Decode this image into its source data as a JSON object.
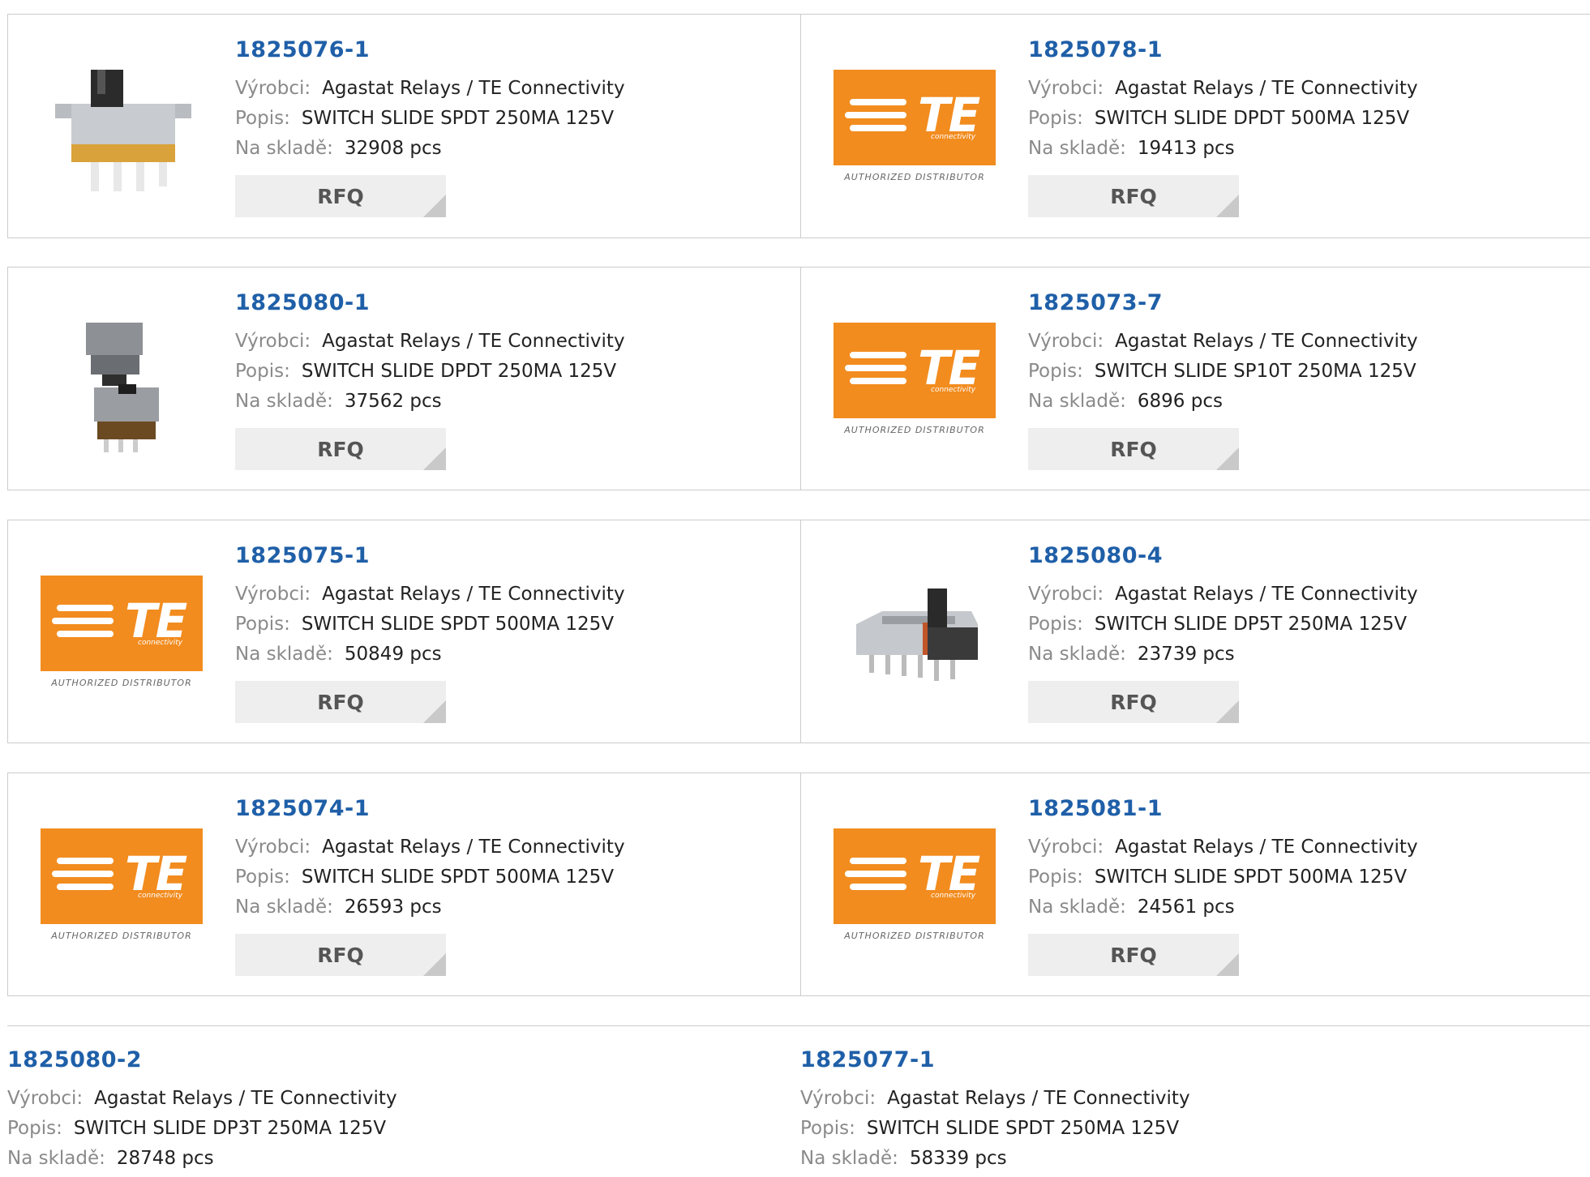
{
  "labels": {
    "manufacturer": "Výrobci:",
    "description": "Popis:",
    "stock": "Na skladě:",
    "rfq": "RFQ"
  },
  "logo": {
    "brand": "TE",
    "sub": "connectivity",
    "caption": "AUTHORIZED DISTRIBUTOR"
  },
  "colors": {
    "link": "#1f5fa8",
    "te_orange": "#f28c1f"
  },
  "products": [
    {
      "pn": "1825076-1",
      "manufacturer": "Agastat Relays / TE Connectivity",
      "description": "SWITCH SLIDE SPDT 250MA 125V",
      "stock": "32908 pcs",
      "image": "slide-switch-spdt-photo"
    },
    {
      "pn": "1825078-1",
      "manufacturer": "Agastat Relays / TE Connectivity",
      "description": "SWITCH SLIDE DPDT 500MA 125V",
      "stock": "19413 pcs",
      "image": "te-logo"
    },
    {
      "pn": "1825080-1",
      "manufacturer": "Agastat Relays / TE Connectivity",
      "description": "SWITCH SLIDE DPDT 250MA 125V",
      "stock": "37562 pcs",
      "image": "slide-switch-dpdt-photo"
    },
    {
      "pn": "1825073-7",
      "manufacturer": "Agastat Relays / TE Connectivity",
      "description": "SWITCH SLIDE SP10T 250MA 125V",
      "stock": "6896 pcs",
      "image": "te-logo"
    },
    {
      "pn": "1825075-1",
      "manufacturer": "Agastat Relays / TE Connectivity",
      "description": "SWITCH SLIDE SPDT 500MA 125V",
      "stock": "50849 pcs",
      "image": "te-logo"
    },
    {
      "pn": "1825080-4",
      "manufacturer": "Agastat Relays / TE Connectivity",
      "description": "SWITCH SLIDE DP5T 250MA 125V",
      "stock": "23739 pcs",
      "image": "slide-switch-dp5t-photo"
    },
    {
      "pn": "1825074-1",
      "manufacturer": "Agastat Relays / TE Connectivity",
      "description": "SWITCH SLIDE SPDT 500MA 125V",
      "stock": "26593 pcs",
      "image": "te-logo"
    },
    {
      "pn": "1825081-1",
      "manufacturer": "Agastat Relays / TE Connectivity",
      "description": "SWITCH SLIDE SPDT 500MA 125V",
      "stock": "24561 pcs",
      "image": "te-logo"
    },
    {
      "pn": "1825080-2",
      "manufacturer": "Agastat Relays / TE Connectivity",
      "description": "SWITCH SLIDE DP3T 250MA 125V",
      "stock": "28748 pcs",
      "image": "none"
    },
    {
      "pn": "1825077-1",
      "manufacturer": "Agastat Relays / TE Connectivity",
      "description": "SWITCH SLIDE SPDT 250MA 125V",
      "stock": "58339 pcs",
      "image": "none"
    }
  ]
}
